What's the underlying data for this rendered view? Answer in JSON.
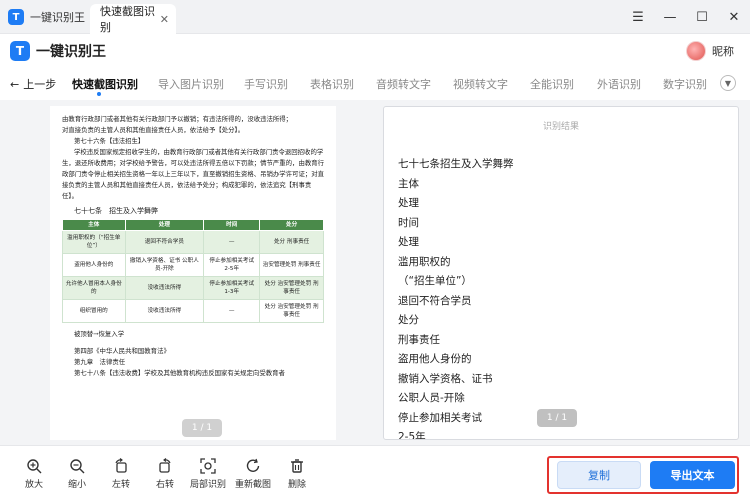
{
  "window": {
    "app_tab": "一键识别王",
    "active_tab": "快速截图识别",
    "tab_close": "✕",
    "controls": [
      "☰",
      "—",
      "☐",
      "✕"
    ]
  },
  "header": {
    "brand": "一键识别王",
    "logo_glyph": "T",
    "username": "昵称"
  },
  "nav": {
    "back": "上一步",
    "tabs": [
      "快速截图识别",
      "导入图片识别",
      "手写识别",
      "表格识别",
      "音频转文字",
      "视频转文字",
      "全能识别",
      "外语识别",
      "数字识别"
    ],
    "active_index": 0
  },
  "document": {
    "lines": [
      "由教育行政部门或者其他有关行政部门予以撤销；有违法所得的，没收违法所得；",
      "对直接负责的主管人员和其他直接责任人员，依法给予【处分】。",
      "第七十六条【违法招生】",
      "学校违反国家规定招收学生的，由教育行政部门或者其他有关行政部门责令退回招收的学生，退还所收费用；对学校给予警告，可以处违法所得五倍以下罚款；情节严重的，由教育行政部门责令停止相关招生资格一年以上三年以下，直至撤销招生资格、吊销办学许可证；对直接负责的主管人员和其他直接责任人员，依法给予处分；构成犯罪的，依法追究【刑事责任】。"
    ],
    "table_caption": "七十七条　招生及入学舞弊",
    "table_headers": [
      "主体",
      "处理",
      "时间",
      "处分"
    ],
    "table_rows": [
      [
        "滥用职权的（“招生单位”）",
        "退回不符合学员",
        "—",
        "处分 刑事责任"
      ],
      [
        "盗用他人身份的",
        "撤销入学资格、证书 公职人员-开除",
        "停止参加相关考试 2-5年",
        "治安管理处罚 刑事责任"
      ],
      [
        "允许他人冒用本人身份的",
        "没收违法所得",
        "停止参加相关考试 1-3年",
        "处分 治安管理处罚 刑事责任"
      ],
      [
        "组织冒用的",
        "没收违法所得",
        "—",
        "处分 治安管理处罚 刑事责任"
      ]
    ],
    "after_lines": [
      "被顶替→恢复入学",
      "第四部《中华人民共和国教育法》",
      "第九章　法律责任",
      "第七十八条【违法收费】学校及其他教育机构违反国家有关规定向受教育者"
    ],
    "page_indicator": "1 / 1"
  },
  "result": {
    "title": "识别结果",
    "lines": [
      "七十七条招生及入学舞弊",
      "主体",
      "处理",
      "时间",
      "处理",
      "滥用职权的",
      "（“招生单位”）",
      "退回不符合学员",
      "处分",
      "刑事责任",
      "盗用他人身份的",
      "撤销入学资格、证书",
      "公职人员-开除",
      "停止参加相关考试",
      "2-5年"
    ],
    "page_indicator": "1 / 1"
  },
  "toolbar": {
    "tools": [
      {
        "label": "放大",
        "icon": "zoom-in-icon"
      },
      {
        "label": "缩小",
        "icon": "zoom-out-icon"
      },
      {
        "label": "左转",
        "icon": "rotate-left-icon"
      },
      {
        "label": "右转",
        "icon": "rotate-right-icon"
      },
      {
        "label": "局部识别",
        "icon": "partial-recognize-icon"
      },
      {
        "label": "重新截图",
        "icon": "refresh-icon"
      },
      {
        "label": "删除",
        "icon": "trash-icon"
      }
    ],
    "copy_label": "复制",
    "export_label": "导出文本"
  },
  "colors": {
    "accent": "#1e7cf4",
    "highlight_box": "#e3322e",
    "table_header": "#4a8a4a"
  }
}
